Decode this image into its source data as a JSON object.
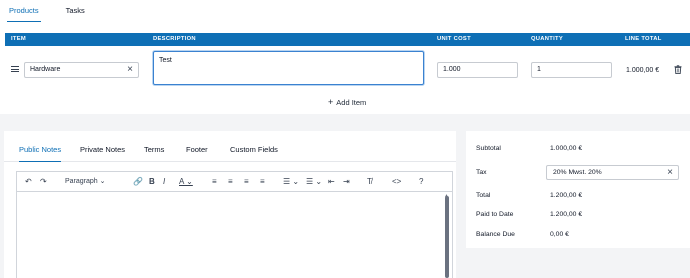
{
  "tabs": [
    {
      "label": "Products",
      "active": true
    },
    {
      "label": "Tasks",
      "active": false
    }
  ],
  "table": {
    "columns": [
      "ITEM",
      "DESCRIPTION",
      "UNIT COST",
      "QUANTITY",
      "LINE TOTAL"
    ],
    "row": {
      "item": "Hardware",
      "description": "Test",
      "unit_cost": "1.000",
      "quantity": "1",
      "line_total": "1.000,00 €"
    }
  },
  "add_item_label": "Add Item",
  "notes": {
    "tabs": [
      "Public Notes",
      "Private Notes",
      "Terms",
      "Footer",
      "Custom Fields"
    ],
    "active_tab": "Public Notes",
    "paragraph_select": "Paragraph"
  },
  "totals": {
    "subtotal_label": "Subtotal",
    "subtotal_value": "1.000,00 €",
    "tax_label": "Tax",
    "tax_value": "20% Mwst. 20%",
    "total_label": "Total",
    "total_value": "1.200,00 €",
    "paid_label": "Paid to Date",
    "paid_value": "1.200,00 €",
    "balance_label": "Balance Due",
    "balance_value": "0,00 €"
  },
  "colors": {
    "accent": "#0e6fb5"
  }
}
